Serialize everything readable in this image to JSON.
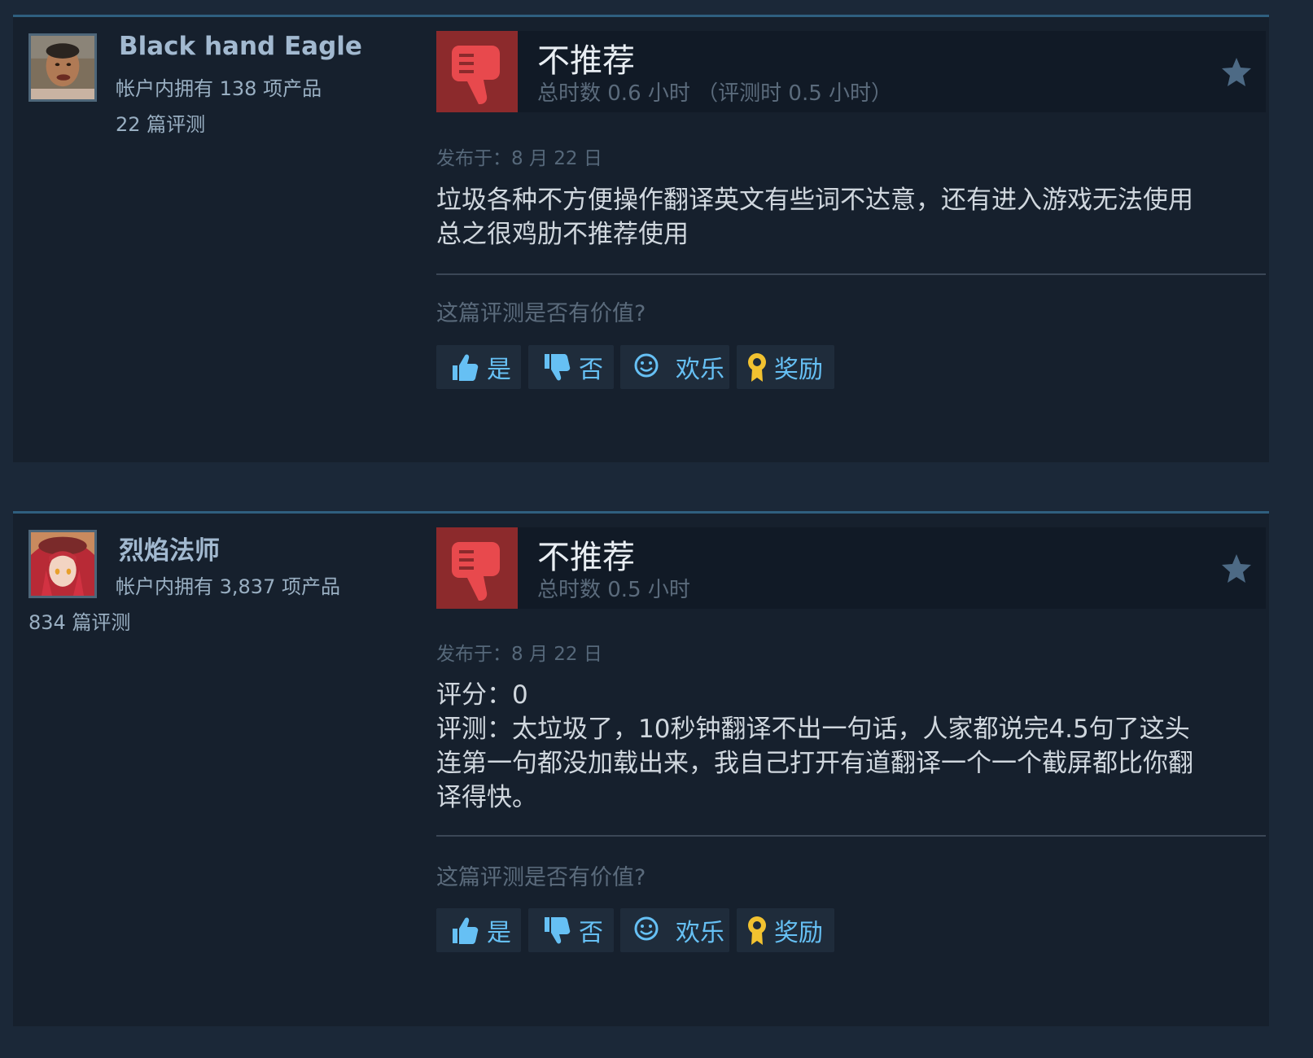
{
  "reviews": [
    {
      "username": "Black hand Eagle",
      "owned": "帐户内拥有 138 项产品",
      "review_count": "22 篇评测",
      "verdict": "不推荐",
      "hours": "总时数 0.6 小时 （评测时 0.5 小时）",
      "posted": "发布于：8 月 22 日",
      "body": [
        "垃圾各种不方便操作翻译英文有些词不达意，还有进入游戏无法使用",
        "总之很鸡肋不推荐使用"
      ],
      "helpful_question": "这篇评测是否有价值?",
      "buttons": {
        "yes": "是",
        "no": "否",
        "funny": "欢乐",
        "award": "奖励"
      }
    },
    {
      "username": "烈焰法师",
      "owned": "帐户内拥有 3,837 项产品",
      "review_count": "834 篇评测",
      "verdict": "不推荐",
      "hours": "总时数 0.5 小时",
      "posted": "发布于：8 月 22 日",
      "body": [
        "评分：0",
        "评测：太垃圾了，10秒钟翻译不出一句话，人家都说完4.5句了这头",
        "连第一句都没加载出来，我自己打开有道翻译一个一个截屏都比你翻",
        "译得快。"
      ],
      "helpful_question": "这篇评测是否有价值?",
      "buttons": {
        "yes": "是",
        "no": "否",
        "funny": "欢乐",
        "award": "奖励"
      }
    }
  ],
  "icons": {
    "verdict": "thumbs-down-icon",
    "star": "star-icon",
    "yes": "thumbs-up-icon",
    "no": "thumbs-down-icon",
    "funny": "smiley-icon",
    "award": "award-ribbon-icon"
  },
  "colors": {
    "background": "#1b2838",
    "panel": "#16202d",
    "accent": "#66c0f4",
    "not_recommended": "#8c2a2c",
    "award": "#f2c230"
  }
}
